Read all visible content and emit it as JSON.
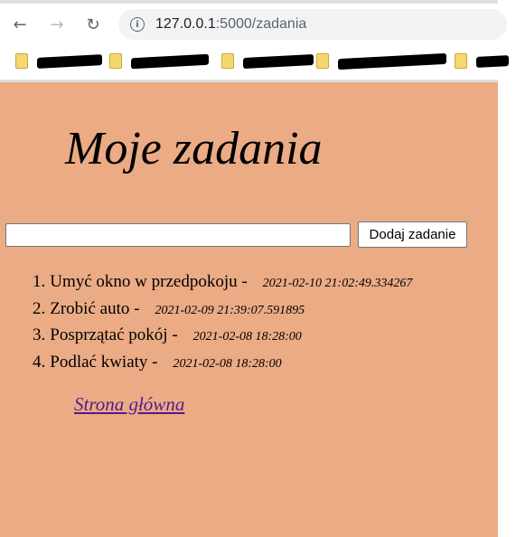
{
  "browser": {
    "url_host": "127.0.0.1",
    "url_rest": ":5000/zadania"
  },
  "page": {
    "title": "Moje zadania",
    "input_value": "",
    "add_button_label": "Dodaj zadanie",
    "tasks": [
      {
        "number": "1.",
        "name": "Umyć okno w przedpokoju -",
        "timestamp": "2021-02-10 21:02:49.334267"
      },
      {
        "number": "2.",
        "name": "Zrobić auto -",
        "timestamp": "2021-02-09 21:39:07.591895"
      },
      {
        "number": "3.",
        "name": "Posprzątać pokój -",
        "timestamp": "2021-02-08 18:28:00"
      },
      {
        "number": "4.",
        "name": "Podlać kwiaty -",
        "timestamp": "2021-02-08 18:28:00"
      }
    ],
    "home_link": "Strona główna"
  }
}
